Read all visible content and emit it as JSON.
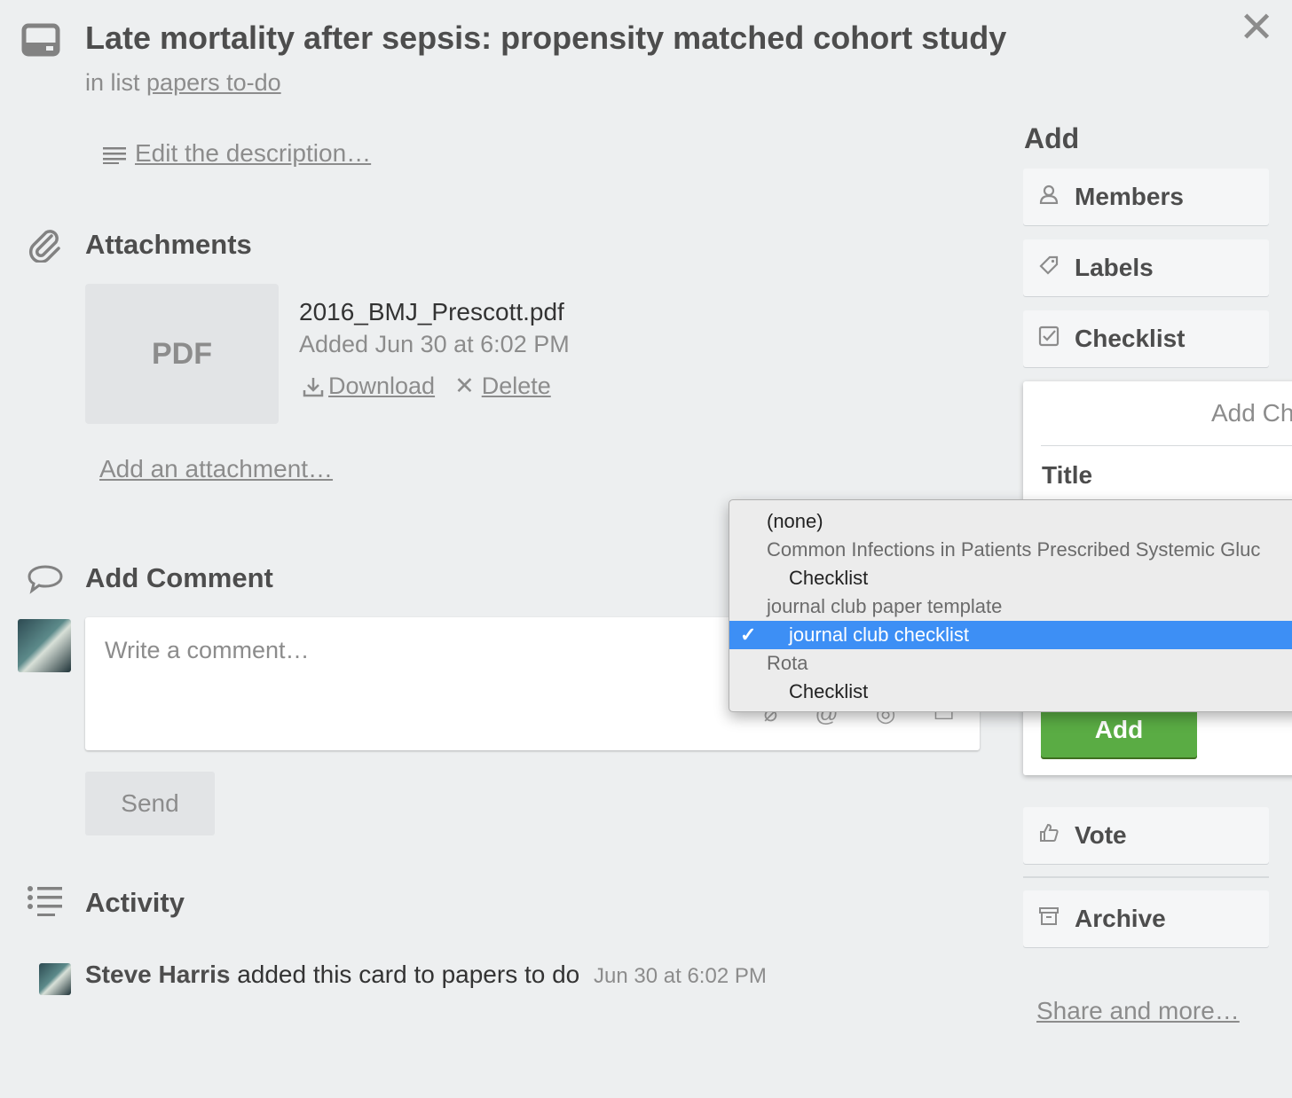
{
  "header": {
    "title": "Late mortality after sepsis: propensity matched cohort study",
    "in_list_prefix": "in list",
    "list_name": "papers to-do",
    "close_glyph": "✕"
  },
  "description": {
    "link": "Edit the description…"
  },
  "attachments": {
    "title": "Attachments",
    "thumb_label": "PDF",
    "file_name": "2016_BMJ_Prescott.pdf",
    "added": "Added Jun 30 at 6:02 PM",
    "download_label": "Download",
    "delete_label": "Delete",
    "add_link": "Add an attachment…"
  },
  "comment": {
    "title": "Add Comment",
    "placeholder": "Write a comment…",
    "send_label": "Send"
  },
  "activity": {
    "title": "Activity",
    "user": "Steve Harris",
    "action": "added this card to papers to do",
    "time": "Jun 30 at 6:02 PM"
  },
  "sidebar": {
    "heading": "Add",
    "members_label": "Members",
    "labels_label": "Labels",
    "checklist_label": "Checklist",
    "vote_label": "Vote",
    "archive_label": "Archive",
    "share_link": "Share and more…"
  },
  "checklist_popover": {
    "title": "Add Ch",
    "field_label": "Title",
    "add_button": "Add"
  },
  "copy_dropdown": {
    "items": [
      {
        "label": "(none)",
        "kind": "option-top",
        "selected": false
      },
      {
        "label": "Common Infections in Patients Prescribed Systemic Gluc",
        "kind": "group",
        "selected": false
      },
      {
        "label": "Checklist",
        "kind": "option",
        "selected": false
      },
      {
        "label": "journal club paper template",
        "kind": "group",
        "selected": false
      },
      {
        "label": "journal club checklist",
        "kind": "option",
        "selected": true
      },
      {
        "label": "Rota",
        "kind": "group",
        "selected": false
      },
      {
        "label": "Checklist",
        "kind": "option",
        "selected": false
      }
    ]
  },
  "colors": {
    "background": "#edeff0",
    "selected_highlight": "#3d8ff5",
    "add_button_green": "#5aac44"
  }
}
